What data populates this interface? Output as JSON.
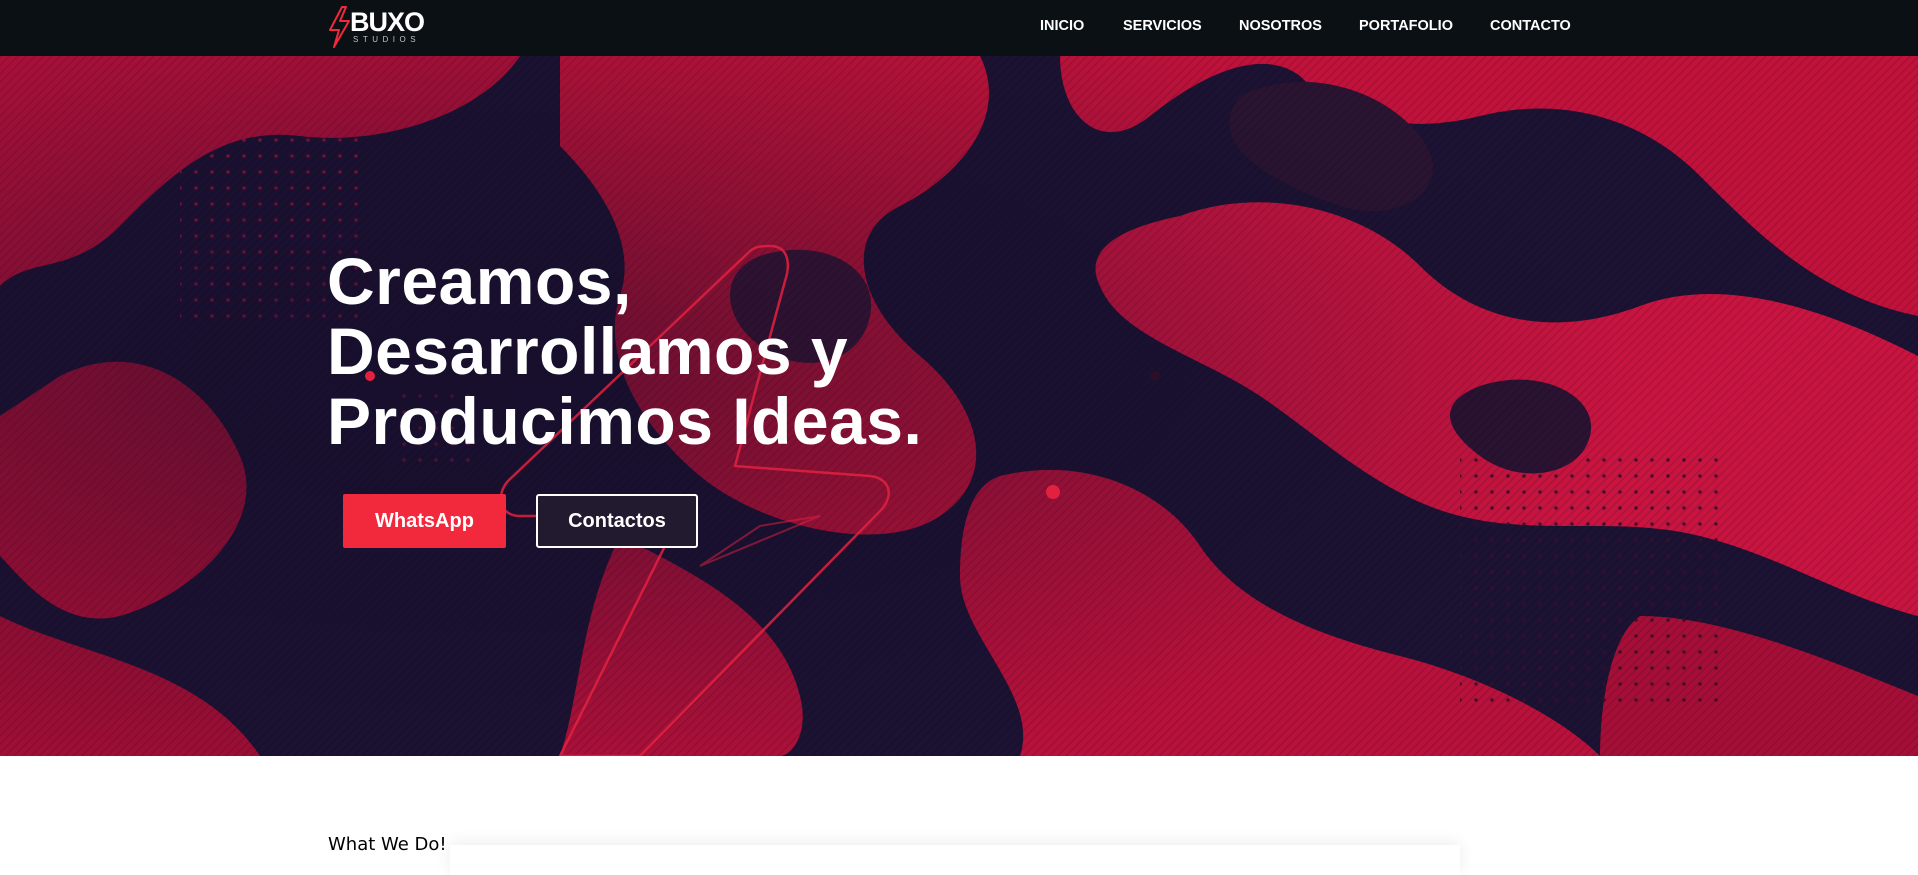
{
  "brand": {
    "name": "BUXO",
    "tagline": "STUDIOS",
    "accent": "#f2283d",
    "nav_bg": "#0b1014"
  },
  "nav": {
    "items": [
      {
        "label": "INICIO"
      },
      {
        "label": "SERVICIOS"
      },
      {
        "label": "NOSOTROS"
      },
      {
        "label": "PORTAFOLIO"
      },
      {
        "label": "CONTACTO"
      }
    ]
  },
  "hero": {
    "title_lines": [
      "Creamos,",
      "Desarrollamos y",
      "Producimos Ideas."
    ],
    "primary_button": "WhatsApp",
    "secondary_button": "Contactos",
    "colors": {
      "crimson": "#c2123a",
      "navy": "#1a1030"
    }
  },
  "section": {
    "label": "What We Do!"
  },
  "icons": [
    "lightning-bolt-icon"
  ]
}
